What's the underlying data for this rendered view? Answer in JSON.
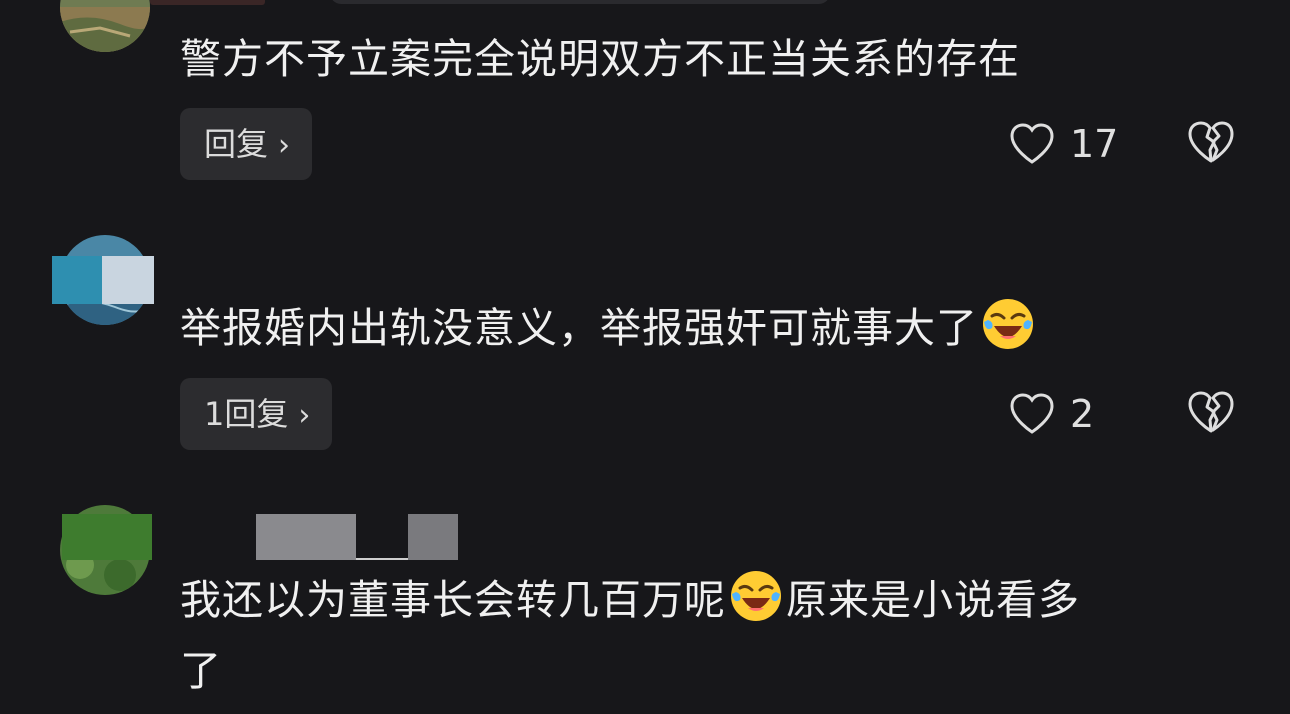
{
  "comments": [
    {
      "text": "警方不予立案完全说明双方不正当关系的存在",
      "reply_label": "回复",
      "likes": "17",
      "avatar": "landscape"
    },
    {
      "text_part1": "举报婚内出轨没意义，举报强奸可就事大了",
      "emoji": "laughing-crying-emoji",
      "reply_label": "1回复",
      "likes": "2",
      "avatar": "wave"
    },
    {
      "text_part1": "我还以为董事长会转几百万呢",
      "text_part2": "原来是小说看多",
      "text_line2": "了",
      "emoji": "laughing-crying-emoji",
      "avatar": "foliage"
    }
  ],
  "icons": {
    "reply_chevron": "›",
    "like": "heart-icon",
    "dislike": "broken-heart-icon"
  },
  "colors": {
    "background": "#17171a",
    "button_bg": "#2c2c2f",
    "text": "#f0f0f0"
  }
}
